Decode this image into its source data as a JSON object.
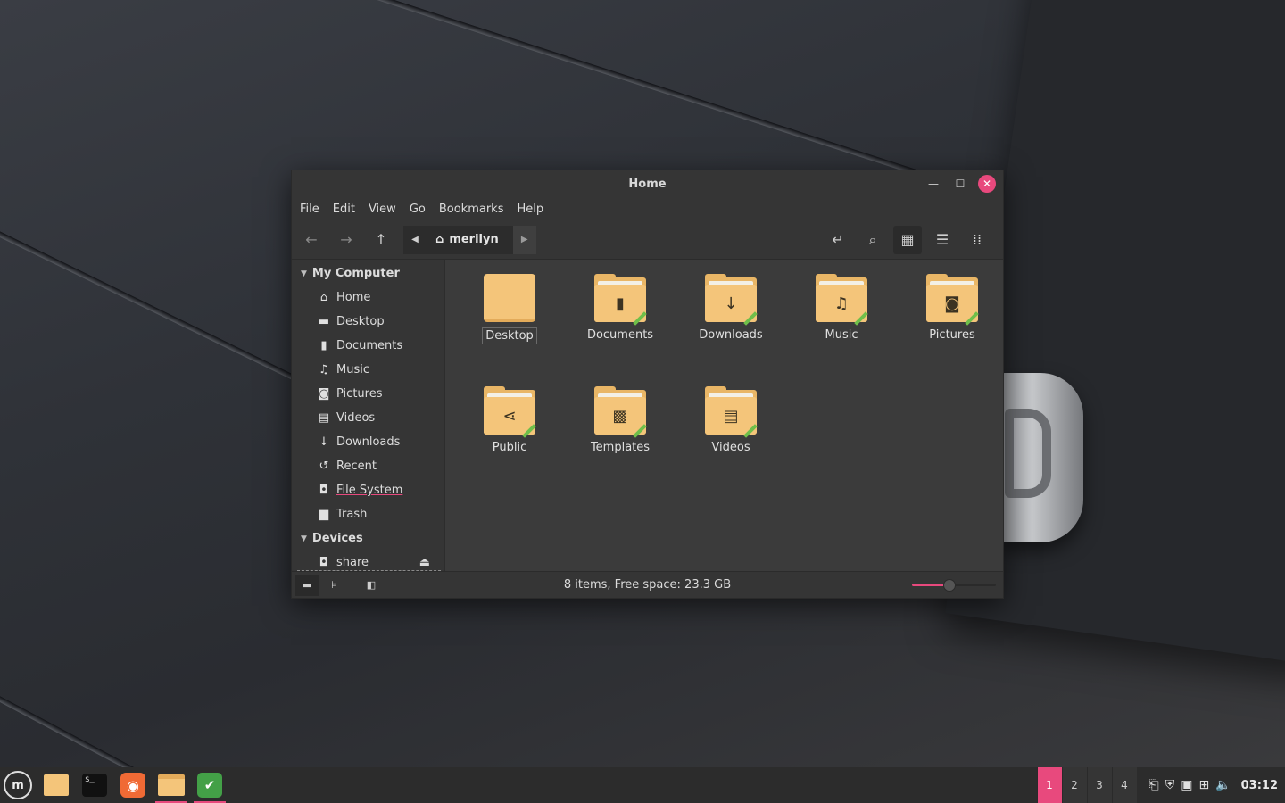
{
  "window": {
    "title": "Home",
    "menus": [
      "File",
      "Edit",
      "View",
      "Go",
      "Bookmarks",
      "Help"
    ],
    "path": {
      "crumb": "merilyn"
    }
  },
  "sidebar": {
    "sections": [
      {
        "header": "My Computer",
        "items": [
          {
            "label": "Home",
            "icon": "home-icon"
          },
          {
            "label": "Desktop",
            "icon": "desktop-icon"
          },
          {
            "label": "Documents",
            "icon": "document-icon"
          },
          {
            "label": "Music",
            "icon": "music-icon"
          },
          {
            "label": "Pictures",
            "icon": "camera-icon"
          },
          {
            "label": "Videos",
            "icon": "film-icon"
          },
          {
            "label": "Downloads",
            "icon": "download-icon"
          },
          {
            "label": "Recent",
            "icon": "history-icon"
          },
          {
            "label": "File System",
            "icon": "drive-icon"
          },
          {
            "label": "Trash",
            "icon": "trash-icon"
          }
        ]
      },
      {
        "header": "Devices",
        "items": [
          {
            "label": "share",
            "icon": "drive-icon"
          }
        ]
      }
    ]
  },
  "files": [
    {
      "label": "Desktop",
      "icon": "plain-folder-icon",
      "selected": true
    },
    {
      "label": "Documents",
      "icon": "document-folder-icon"
    },
    {
      "label": "Downloads",
      "icon": "download-folder-icon"
    },
    {
      "label": "Music",
      "icon": "music-folder-icon"
    },
    {
      "label": "Pictures",
      "icon": "camera-folder-icon"
    },
    {
      "label": "Public",
      "icon": "share-folder-icon"
    },
    {
      "label": "Templates",
      "icon": "template-folder-icon"
    },
    {
      "label": "Videos",
      "icon": "film-folder-icon"
    }
  ],
  "status": {
    "text": "8 items, Free space: 23.3 GB",
    "zoom_fraction": 0.45
  },
  "taskbar": {
    "workspaces": [
      "1",
      "2",
      "3",
      "4"
    ],
    "active_workspace": "1",
    "clock": "03:12"
  },
  "colors": {
    "accent": "#e8497d",
    "folder": "#f4c57a",
    "window_bg": "#3a3a3a"
  }
}
